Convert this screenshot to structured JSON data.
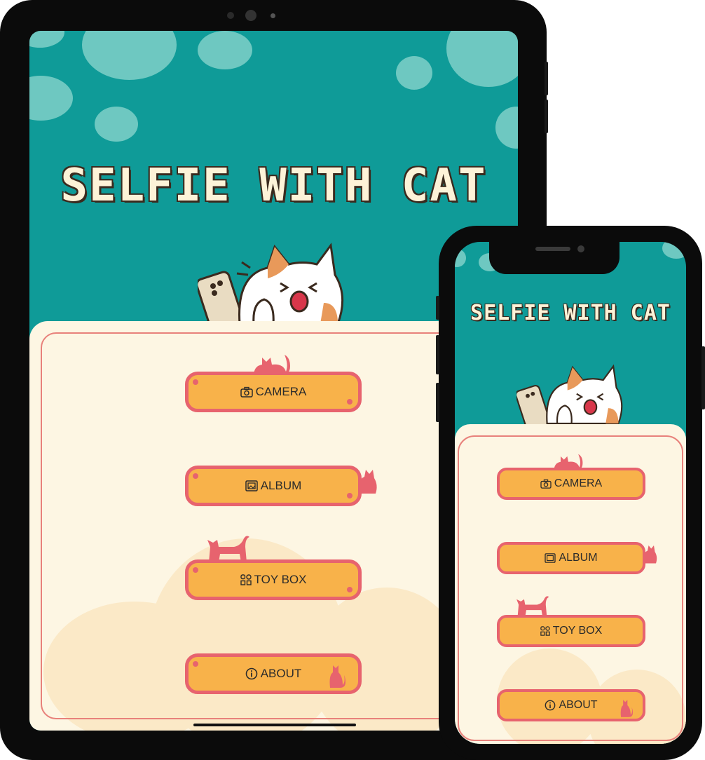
{
  "app": {
    "title": "SELFIE WITH CAT",
    "menu": [
      {
        "label": "CAMERA",
        "icon": "camera-icon"
      },
      {
        "label": "ALBUM",
        "icon": "album-icon"
      },
      {
        "label": "TOY BOX",
        "icon": "toy-box-icon"
      },
      {
        "label": "ABOUT",
        "icon": "info-icon"
      }
    ]
  },
  "colors": {
    "background_teal": "#0f9b98",
    "panel_cream": "#fdf6e3",
    "button_orange": "#f8b24a",
    "button_border": "#e7636e",
    "title_text": "#fdf3d8"
  }
}
